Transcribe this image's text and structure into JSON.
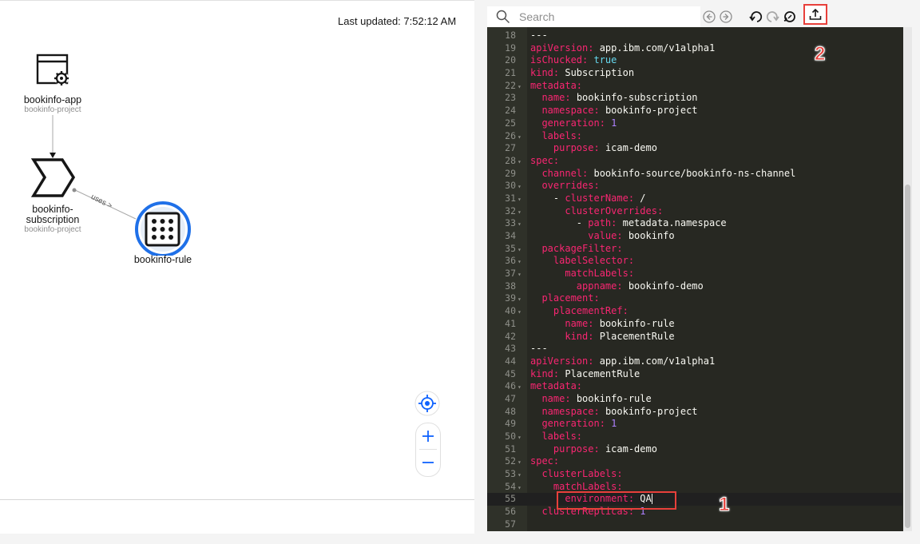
{
  "topology": {
    "last_updated": "Last updated: 7:52:12 AM",
    "nodes": {
      "app": {
        "name": "bookinfo-app",
        "namespace": "bookinfo-project"
      },
      "subscription": {
        "name_line1": "bookinfo-",
        "name_line2": "subscription",
        "namespace": "bookinfo-project"
      },
      "rule": {
        "name": "bookinfo-rule"
      }
    },
    "edge_label": "uses >",
    "zoom_controls": [
      "target-icon",
      "plus-icon",
      "minus-icon"
    ]
  },
  "toolbar": {
    "search_placeholder": "Search",
    "icons": [
      "search-icon",
      "prev-match-icon",
      "next-match-icon",
      "undo-icon",
      "redo-icon",
      "reset-icon",
      "upload-icon"
    ]
  },
  "editor": {
    "lines": [
      {
        "n": "18",
        "fold": "",
        "parts": [
          [
            "txt",
            "---"
          ]
        ]
      },
      {
        "n": "19",
        "fold": "",
        "parts": [
          [
            "k",
            "apiVersion: "
          ],
          [
            "v",
            "app.ibm.com/v1alpha1"
          ]
        ]
      },
      {
        "n": "20",
        "fold": "",
        "parts": [
          [
            "k",
            "isChucked: "
          ],
          [
            "b",
            "true"
          ]
        ]
      },
      {
        "n": "21",
        "fold": "",
        "parts": [
          [
            "k",
            "kind: "
          ],
          [
            "v",
            "Subscription"
          ]
        ]
      },
      {
        "n": "22",
        "fold": "▾",
        "parts": [
          [
            "k",
            "metadata:"
          ]
        ]
      },
      {
        "n": "23",
        "fold": "",
        "parts": [
          [
            "txt",
            "  "
          ],
          [
            "k",
            "name: "
          ],
          [
            "v",
            "bookinfo-subscription"
          ]
        ]
      },
      {
        "n": "24",
        "fold": "",
        "parts": [
          [
            "txt",
            "  "
          ],
          [
            "k",
            "namespace: "
          ],
          [
            "v",
            "bookinfo-project"
          ]
        ]
      },
      {
        "n": "25",
        "fold": "",
        "parts": [
          [
            "txt",
            "  "
          ],
          [
            "k",
            "generation: "
          ],
          [
            "n",
            "1"
          ]
        ]
      },
      {
        "n": "26",
        "fold": "▾",
        "parts": [
          [
            "txt",
            "  "
          ],
          [
            "k",
            "labels:"
          ]
        ]
      },
      {
        "n": "27",
        "fold": "",
        "parts": [
          [
            "txt",
            "    "
          ],
          [
            "k",
            "purpose: "
          ],
          [
            "v",
            "icam-demo"
          ]
        ]
      },
      {
        "n": "28",
        "fold": "▾",
        "parts": [
          [
            "k",
            "spec:"
          ]
        ]
      },
      {
        "n": "29",
        "fold": "",
        "parts": [
          [
            "txt",
            "  "
          ],
          [
            "k",
            "channel: "
          ],
          [
            "v",
            "bookinfo-source/bookinfo-ns-channel"
          ]
        ]
      },
      {
        "n": "30",
        "fold": "▾",
        "parts": [
          [
            "txt",
            "  "
          ],
          [
            "k",
            "overrides:"
          ]
        ]
      },
      {
        "n": "31",
        "fold": "▾",
        "parts": [
          [
            "txt",
            "    - "
          ],
          [
            "k",
            "clusterName: "
          ],
          [
            "v",
            "/"
          ]
        ]
      },
      {
        "n": "32",
        "fold": "▾",
        "parts": [
          [
            "txt",
            "      "
          ],
          [
            "k",
            "clusterOverrides:"
          ]
        ]
      },
      {
        "n": "33",
        "fold": "▾",
        "parts": [
          [
            "txt",
            "        - "
          ],
          [
            "k",
            "path: "
          ],
          [
            "v",
            "metadata.namespace"
          ]
        ]
      },
      {
        "n": "34",
        "fold": "",
        "parts": [
          [
            "txt",
            "          "
          ],
          [
            "k",
            "value: "
          ],
          [
            "v",
            "bookinfo"
          ]
        ]
      },
      {
        "n": "35",
        "fold": "▾",
        "parts": [
          [
            "txt",
            "  "
          ],
          [
            "k",
            "packageFilter:"
          ]
        ]
      },
      {
        "n": "36",
        "fold": "▾",
        "parts": [
          [
            "txt",
            "    "
          ],
          [
            "k",
            "labelSelector:"
          ]
        ]
      },
      {
        "n": "37",
        "fold": "▾",
        "parts": [
          [
            "txt",
            "      "
          ],
          [
            "k",
            "matchLabels:"
          ]
        ]
      },
      {
        "n": "38",
        "fold": "",
        "parts": [
          [
            "txt",
            "        "
          ],
          [
            "k",
            "appname: "
          ],
          [
            "v",
            "bookinfo-demo"
          ]
        ]
      },
      {
        "n": "39",
        "fold": "▾",
        "parts": [
          [
            "txt",
            "  "
          ],
          [
            "k",
            "placement:"
          ]
        ]
      },
      {
        "n": "40",
        "fold": "▾",
        "parts": [
          [
            "txt",
            "    "
          ],
          [
            "k",
            "placementRef:"
          ]
        ]
      },
      {
        "n": "41",
        "fold": "",
        "parts": [
          [
            "txt",
            "      "
          ],
          [
            "k",
            "name: "
          ],
          [
            "v",
            "bookinfo-rule"
          ]
        ]
      },
      {
        "n": "42",
        "fold": "",
        "parts": [
          [
            "txt",
            "      "
          ],
          [
            "k",
            "kind: "
          ],
          [
            "v",
            "PlacementRule"
          ]
        ]
      },
      {
        "n": "43",
        "fold": "",
        "parts": [
          [
            "txt",
            "---"
          ]
        ]
      },
      {
        "n": "44",
        "fold": "",
        "parts": [
          [
            "k",
            "apiVersion: "
          ],
          [
            "v",
            "app.ibm.com/v1alpha1"
          ]
        ]
      },
      {
        "n": "45",
        "fold": "",
        "parts": [
          [
            "k",
            "kind: "
          ],
          [
            "v",
            "PlacementRule"
          ]
        ]
      },
      {
        "n": "46",
        "fold": "▾",
        "parts": [
          [
            "k",
            "metadata:"
          ]
        ]
      },
      {
        "n": "47",
        "fold": "",
        "parts": [
          [
            "txt",
            "  "
          ],
          [
            "k",
            "name: "
          ],
          [
            "v",
            "bookinfo-rule"
          ]
        ]
      },
      {
        "n": "48",
        "fold": "",
        "parts": [
          [
            "txt",
            "  "
          ],
          [
            "k",
            "namespace: "
          ],
          [
            "v",
            "bookinfo-project"
          ]
        ]
      },
      {
        "n": "49",
        "fold": "",
        "parts": [
          [
            "txt",
            "  "
          ],
          [
            "k",
            "generation: "
          ],
          [
            "n",
            "1"
          ]
        ]
      },
      {
        "n": "50",
        "fold": "▾",
        "parts": [
          [
            "txt",
            "  "
          ],
          [
            "k",
            "labels:"
          ]
        ]
      },
      {
        "n": "51",
        "fold": "",
        "parts": [
          [
            "txt",
            "    "
          ],
          [
            "k",
            "purpose: "
          ],
          [
            "v",
            "icam-demo"
          ]
        ]
      },
      {
        "n": "52",
        "fold": "▾",
        "parts": [
          [
            "k",
            "spec:"
          ]
        ]
      },
      {
        "n": "53",
        "fold": "▾",
        "parts": [
          [
            "txt",
            "  "
          ],
          [
            "k",
            "clusterLabels:"
          ]
        ]
      },
      {
        "n": "54",
        "fold": "▾",
        "parts": [
          [
            "txt",
            "    "
          ],
          [
            "k",
            "matchLabels:"
          ]
        ]
      },
      {
        "n": "55",
        "fold": "",
        "active": true,
        "parts": [
          [
            "txt",
            "      "
          ],
          [
            "k",
            "environment: "
          ],
          [
            "v",
            "QA"
          ]
        ]
      },
      {
        "n": "56",
        "fold": "",
        "parts": [
          [
            "txt",
            "  "
          ],
          [
            "k",
            "clusterReplicas: "
          ],
          [
            "n",
            "1"
          ]
        ]
      },
      {
        "n": "57",
        "fold": "",
        "parts": [
          [
            "txt",
            ""
          ]
        ]
      }
    ]
  },
  "annotations": {
    "step1": "1",
    "step2": "2"
  },
  "colors": {
    "annotation": "#e8403b",
    "editor_bg": "#272822",
    "key": "#f92672",
    "bool": "#66d9ef",
    "number": "#ae81ff",
    "accent_blue": "#0f62fe"
  }
}
